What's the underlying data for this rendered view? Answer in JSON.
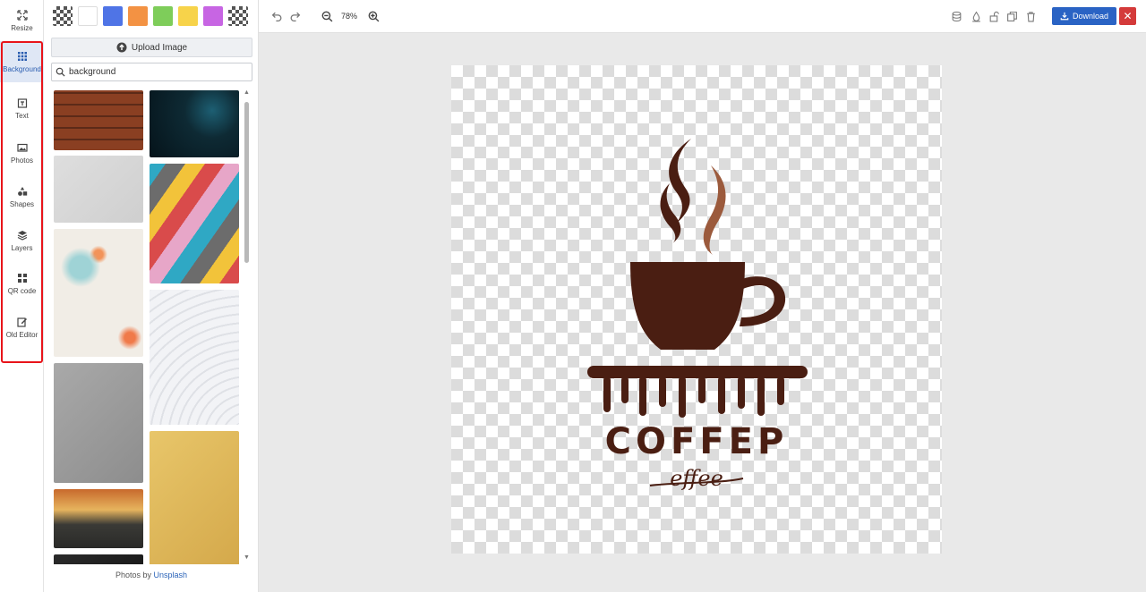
{
  "nav": {
    "items": [
      {
        "label": "Resize",
        "icon": "resize-icon"
      },
      {
        "label": "Background",
        "icon": "grid-icon",
        "active": true
      },
      {
        "label": "Text",
        "icon": "text-icon"
      },
      {
        "label": "Photos",
        "icon": "image-icon"
      },
      {
        "label": "Shapes",
        "icon": "shapes-icon"
      },
      {
        "label": "Layers",
        "icon": "layers-icon"
      },
      {
        "label": "QR code",
        "icon": "qr-icon"
      },
      {
        "label": "Old Editor",
        "icon": "edit-icon"
      }
    ]
  },
  "panel": {
    "swatch_colors": [
      "transparent",
      "#ffffff",
      "#4f74e6",
      "#f39243",
      "#7ecd5a",
      "#f7d34a",
      "#c765e3",
      "transparent"
    ],
    "upload_label": "Upload Image",
    "search": {
      "value": "background",
      "placeholder": ""
    },
    "thumbs_left": [
      {
        "subject": "wood-planks",
        "colors": [
          "#8a3f22",
          "#5c2a18"
        ]
      },
      {
        "subject": "white-texture",
        "colors": [
          "#dedede",
          "#cfcfcf"
        ]
      },
      {
        "subject": "watercolor-splash",
        "colors": [
          "#f1ede6",
          "#a9d5d8"
        ]
      },
      {
        "subject": "gray-concrete",
        "colors": [
          "#a9a9a9",
          "#8d8d8d"
        ]
      },
      {
        "subject": "forest-road",
        "colors": [
          "#3a3a36",
          "#c8692c"
        ]
      },
      {
        "subject": "dark-texture",
        "colors": [
          "#2a2a2a",
          "#1a1a1a"
        ]
      }
    ],
    "thumbs_right": [
      {
        "subject": "dark-teal-bokeh",
        "colors": [
          "#0e2a34",
          "#05131a"
        ]
      },
      {
        "subject": "painted-stripes",
        "colors": [
          "#d94b4b",
          "#f2c33a"
        ]
      },
      {
        "subject": "white-curves",
        "colors": [
          "#f2f3f6",
          "#dfe1e6"
        ]
      },
      {
        "subject": "yellow-wall",
        "colors": [
          "#e8c66a",
          "#d4a84a"
        ]
      }
    ],
    "credit_prefix": "Photos by ",
    "credit_link": "Unsplash"
  },
  "toolbar": {
    "zoom": "78%",
    "download_label": "Download",
    "close_label": "✕"
  },
  "canvas": {
    "brand": "COFFEP",
    "tagline": "effee",
    "colors": {
      "dark": "#4a1e12",
      "light": "#9b5a3c"
    }
  }
}
